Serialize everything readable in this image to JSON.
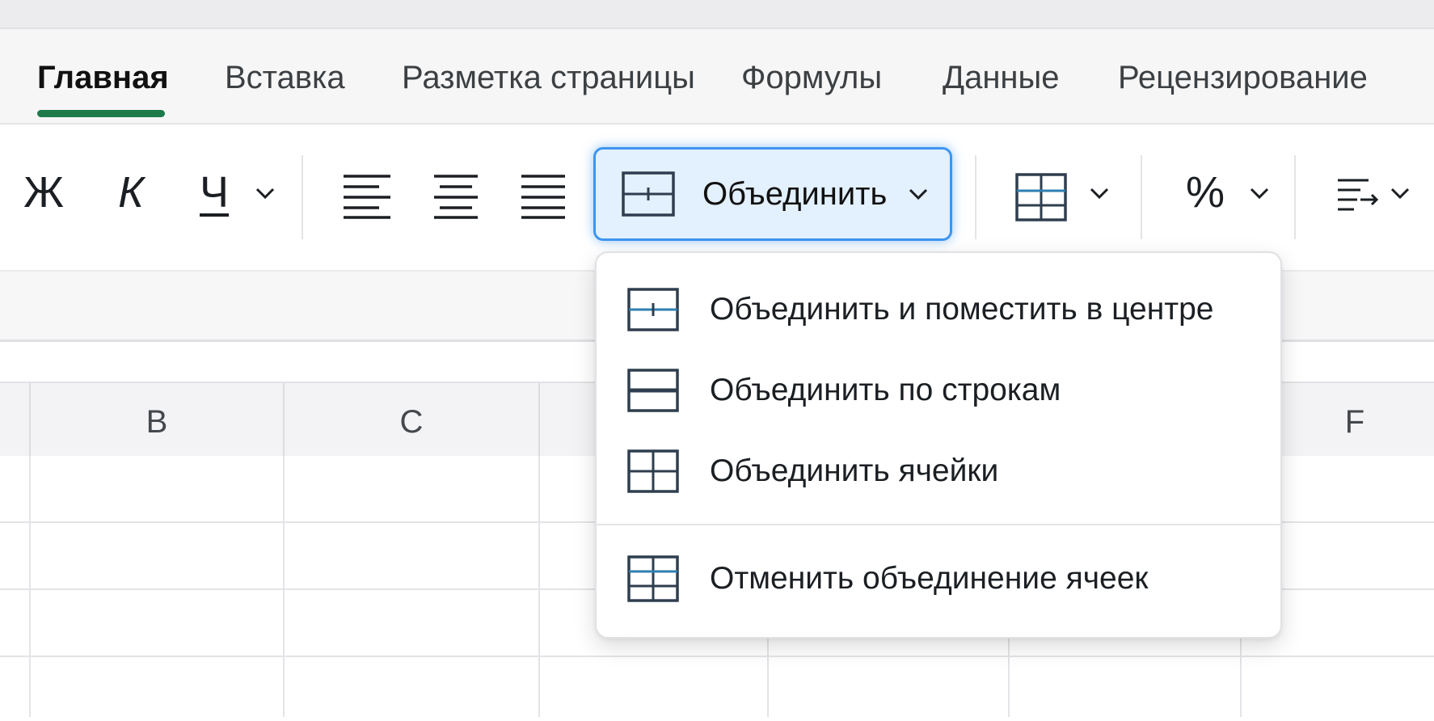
{
  "tabs": [
    {
      "label": "Главная",
      "active": true
    },
    {
      "label": "Вставка",
      "active": false
    },
    {
      "label": "Разметка страницы",
      "active": false
    },
    {
      "label": "Формулы",
      "active": false
    },
    {
      "label": "Данные",
      "active": false
    },
    {
      "label": "Рецензирование",
      "active": false
    }
  ],
  "toolbar": {
    "bold_label": "Ж",
    "italic_label": "К",
    "underline_label": "Ч",
    "merge_label": "Объединить",
    "percent_label": "%"
  },
  "columns": [
    "B",
    "C",
    "F"
  ],
  "merge_menu": {
    "items": [
      {
        "label": "Объединить и поместить в центре",
        "icon": "merge-center-icon"
      },
      {
        "label": "Объединить по строкам",
        "icon": "merge-across-icon"
      },
      {
        "label": "Объединить ячейки",
        "icon": "merge-cells-icon"
      },
      {
        "label": "Отменить объединение ячеек",
        "icon": "unmerge-cells-icon"
      }
    ]
  },
  "colors": {
    "accent": "#3d95ef",
    "active_tab_underline": "#1f7a4a",
    "icon_stroke": "#2f3e4e",
    "icon_accent": "#2f7fb0"
  }
}
